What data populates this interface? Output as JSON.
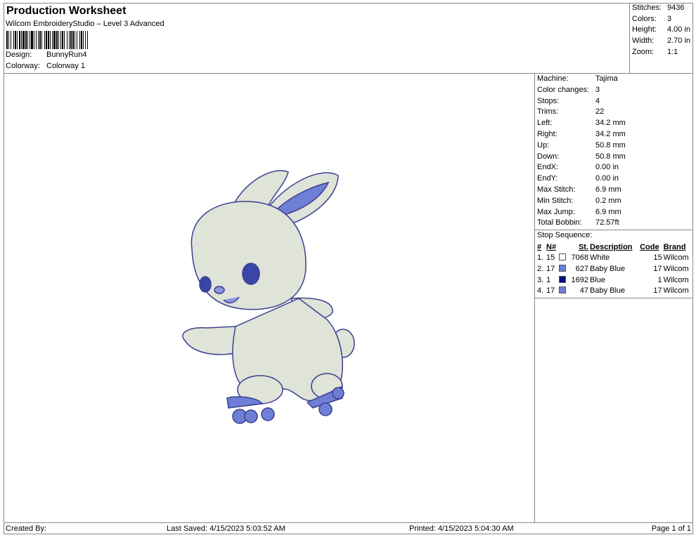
{
  "header": {
    "title": "Production Worksheet",
    "subtitle": "Wilcom EmbroideryStudio – Level 3 Advanced",
    "design_label": "Design:",
    "design": "BunnyRun4",
    "colorway_label": "Colorway:",
    "colorway": "Colorway 1"
  },
  "stats": [
    {
      "k": "Stitches:",
      "v": "9436"
    },
    {
      "k": "Colors:",
      "v": "3"
    },
    {
      "k": "Height:",
      "v": "4.00 in"
    },
    {
      "k": "Width:",
      "v": "2.70 in"
    },
    {
      "k": "Zoom:",
      "v": "1:1"
    }
  ],
  "info": [
    {
      "k": "Machine:",
      "v": "Tajima"
    },
    {
      "k": "Color changes:",
      "v": "3"
    },
    {
      "k": "Stops:",
      "v": "4"
    },
    {
      "k": "Trims:",
      "v": "22"
    },
    {
      "k": "Left:",
      "v": "34.2 mm"
    },
    {
      "k": "Right:",
      "v": "34.2 mm"
    },
    {
      "k": "Up:",
      "v": "50.8 mm"
    },
    {
      "k": "Down:",
      "v": "50.8 mm"
    },
    {
      "k": "EndX:",
      "v": "0.00 in"
    },
    {
      "k": "EndY:",
      "v": "0.00 in"
    },
    {
      "k": "Max Stitch:",
      "v": "6.9 mm"
    },
    {
      "k": "Min Stitch:",
      "v": "0.2 mm"
    },
    {
      "k": "Max Jump:",
      "v": "6.9 mm"
    },
    {
      "k": "Total Bobbin:",
      "v": "72.57ft"
    }
  ],
  "stop_sequence": {
    "title": "Stop Sequence:",
    "columns": [
      "#",
      "N#",
      "St.",
      "Description",
      "Code",
      "Brand"
    ],
    "rows": [
      {
        "i": "1.",
        "n": "15",
        "color": "#ffffff",
        "st": "7068",
        "desc": "White",
        "code": "15",
        "brand": "Wilcom"
      },
      {
        "i": "2.",
        "n": "17",
        "color": "#6f7fd6",
        "st": "627",
        "desc": "Baby Blue",
        "code": "17",
        "brand": "Wilcom"
      },
      {
        "i": "3.",
        "n": "1",
        "color": "#0a0a7a",
        "st": "1692",
        "desc": "Blue",
        "code": "1",
        "brand": "Wilcom"
      },
      {
        "i": "4.",
        "n": "17",
        "color": "#6f7fd6",
        "st": "47",
        "desc": "Baby Blue",
        "code": "17",
        "brand": "Wilcom"
      }
    ]
  },
  "footer": {
    "created": "Created By:",
    "saved": "Last Saved: 4/15/2023 5:03:52 AM",
    "printed": "Printed: 4/15/2023 5:04:30 AM",
    "page": "Page 1 of 1"
  }
}
